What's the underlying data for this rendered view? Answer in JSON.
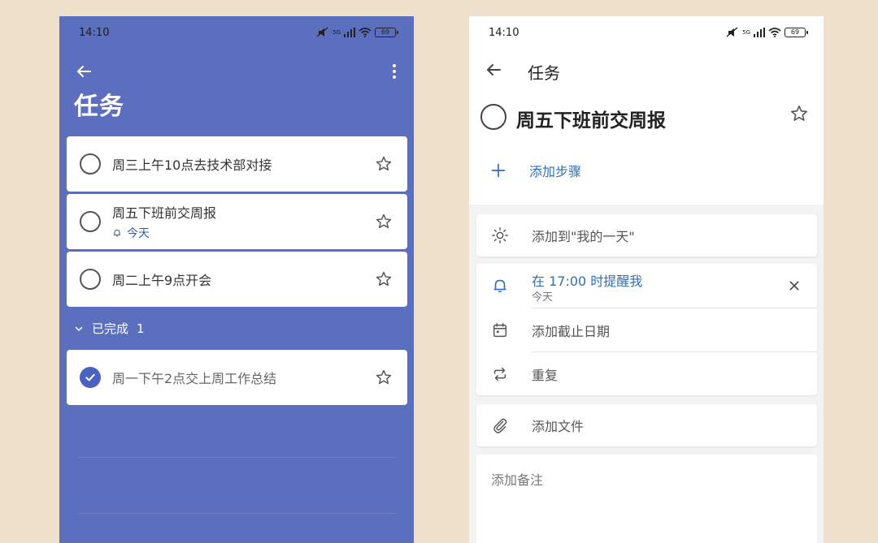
{
  "status_bar": {
    "time": "14:10",
    "battery": "69",
    "network": "5G"
  },
  "left": {
    "title": "任务",
    "tasks": [
      {
        "text": "周三上午10点去技术部对接",
        "starred": false
      },
      {
        "text": "周五下班前交周报",
        "reminder": "今天",
        "starred": false
      },
      {
        "text": "周二上午9点开会",
        "starred": false
      }
    ],
    "completed_label": "已完成",
    "completed_count": "1",
    "completed_tasks": [
      {
        "text": "周一下午2点交上周工作总结"
      }
    ]
  },
  "right": {
    "header_title": "任务",
    "task_title": "周五下班前交周报",
    "add_step": "添加步骤",
    "add_my_day": "添加到\"我的一天\"",
    "reminder_main": "在 17:00 时提醒我",
    "reminder_sub": "今天",
    "due_date": "添加截止日期",
    "repeat": "重复",
    "add_file": "添加文件",
    "add_note": "添加备注"
  },
  "colors": {
    "left_bg": "#5c6fbf",
    "accent_blue": "#2f6fb5",
    "page_bg": "#efe0cc"
  },
  "icons": [
    "back-arrow-icon",
    "more-vert-icon",
    "star-icon",
    "bell-icon",
    "check-icon",
    "plus-icon",
    "sun-icon",
    "calendar-icon",
    "repeat-icon",
    "paperclip-icon",
    "close-icon",
    "chevron-down-icon"
  ]
}
